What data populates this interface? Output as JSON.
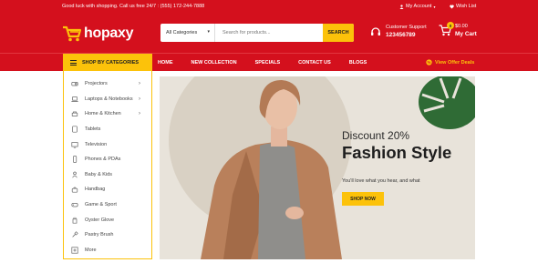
{
  "topbar": {
    "promo": "Good luck with shopping. Call us free 24/7 : (555) 172-244-7888",
    "account": "My Account",
    "wishlist": "Wish List"
  },
  "header": {
    "logo_text": "hopaxy",
    "search": {
      "category": "All Categories",
      "placeholder": "Search for products...",
      "button": "SEARCH"
    },
    "support": {
      "label": "Customer Support",
      "phone": "123456789"
    },
    "cart": {
      "count": "0",
      "amount": "$0.00",
      "label": "My Cart"
    }
  },
  "nav": {
    "categories_button": "SHOP BY CATEGORIES",
    "items": [
      "HOME",
      "NEW COLLECTION",
      "SPECIALS",
      "CONTACT US",
      "BLOGS"
    ],
    "offer": "View Offer Deals"
  },
  "sidebar": {
    "items": [
      {
        "label": "Projectors",
        "icon": "projector-icon",
        "submenu": true
      },
      {
        "label": "Laptops & Notebooks",
        "icon": "laptop-icon",
        "submenu": true
      },
      {
        "label": "Home & Kitchen",
        "icon": "kitchen-icon",
        "submenu": true
      },
      {
        "label": "Tablets",
        "icon": "tablet-icon",
        "submenu": false
      },
      {
        "label": "Television",
        "icon": "television-icon",
        "submenu": false
      },
      {
        "label": "Phones & PDAs",
        "icon": "phone-icon",
        "submenu": false
      },
      {
        "label": "Baby & Kids",
        "icon": "baby-icon",
        "submenu": false
      },
      {
        "label": "Handbag",
        "icon": "handbag-icon",
        "submenu": false
      },
      {
        "label": "Game & Sport",
        "icon": "game-icon",
        "submenu": false
      },
      {
        "label": "Oyster Glove",
        "icon": "glove-icon",
        "submenu": false
      },
      {
        "label": "Pastry Brush",
        "icon": "brush-icon",
        "submenu": false
      },
      {
        "label": "More",
        "icon": "plus-icon",
        "submenu": false
      }
    ]
  },
  "banner": {
    "discount": "Discount 20%",
    "title": "Fashion Style",
    "subtitle": "You'll love what you hear, and what",
    "button": "SHOP NOW"
  },
  "colors": {
    "brand_red": "#d4101d",
    "accent_yellow": "#fcc20a",
    "banner_bg": "#e8e3da"
  }
}
